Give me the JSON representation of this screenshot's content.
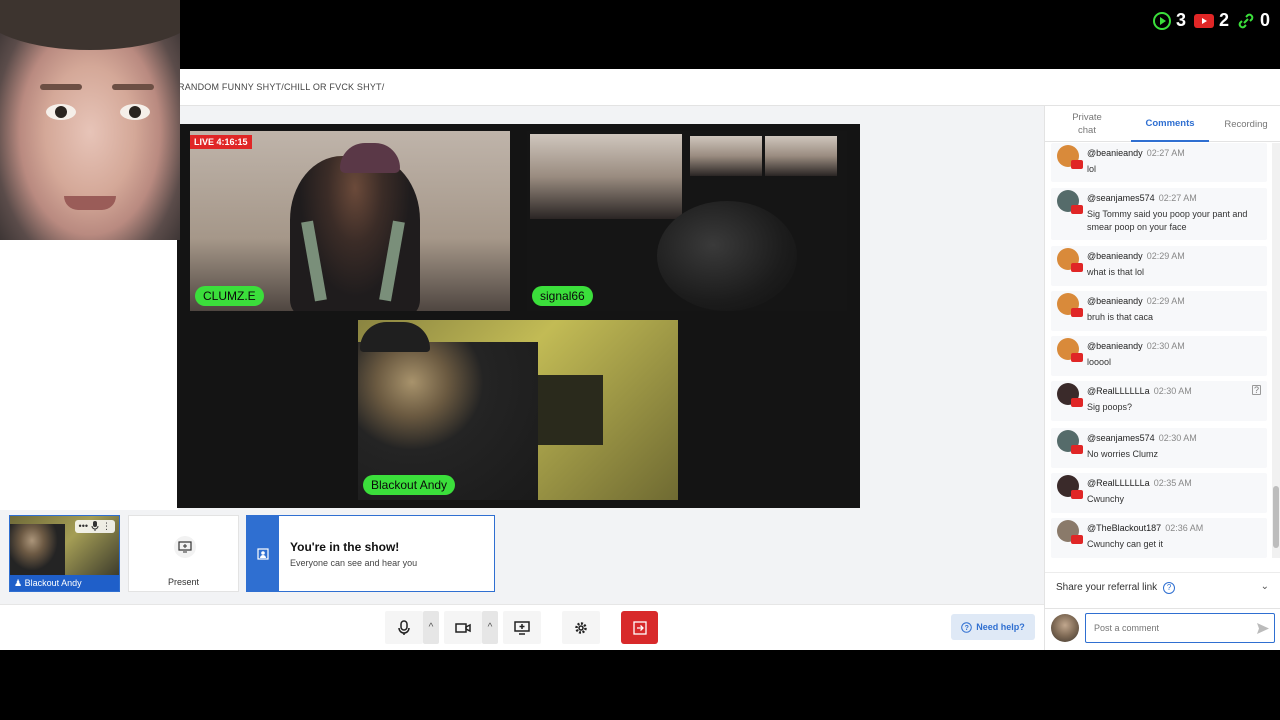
{
  "stats": {
    "play_count": "3",
    "youtube_count": "2",
    "link_count": "0"
  },
  "url": {
    "text": "RANDOM FUNNY SHYT/CHILL OR FVCK SHYT/"
  },
  "stage": {
    "live_badge": "LIVE 4:16:15",
    "participants": [
      {
        "name": "CLUMZ.E"
      },
      {
        "name": "signal66"
      },
      {
        "name": "Blackout Andy"
      }
    ]
  },
  "bottom": {
    "self_label": "Blackout Andy",
    "present_label": "Present",
    "inshow_title": "You're in the show!",
    "inshow_sub": "Everyone can see and hear you"
  },
  "toolbar": {
    "help_label": "Need help?",
    "caret": "^"
  },
  "panel": {
    "tabs": [
      {
        "label": "Private chat"
      },
      {
        "label": "Comments"
      },
      {
        "label": "Recording"
      }
    ],
    "comments": [
      {
        "user": "@beanieandy",
        "time": "02:27 AM",
        "text": "lol",
        "avatar_color": "#d98a3a"
      },
      {
        "user": "@seanjames574",
        "time": "02:27 AM",
        "text": "Sig Tommy said you poop your pant and smear poop on your face",
        "avatar_color": "#556b6a"
      },
      {
        "user": "@beanieandy",
        "time": "02:29 AM",
        "text": "what is that lol",
        "avatar_color": "#d98a3a"
      },
      {
        "user": "@beanieandy",
        "time": "02:29 AM",
        "text": "bruh is that caca",
        "avatar_color": "#d98a3a"
      },
      {
        "user": "@beanieandy",
        "time": "02:30 AM",
        "text": "looool",
        "avatar_color": "#d98a3a"
      },
      {
        "user": "@RealLLLLLLa",
        "time": "02:30 AM",
        "text": "Sig poops?",
        "avatar_color": "#3a2a2a"
      },
      {
        "user": "@seanjames574",
        "time": "02:30 AM",
        "text": "No worries Clumz",
        "avatar_color": "#556b6a"
      },
      {
        "user": "@RealLLLLLLa",
        "time": "02:35 AM",
        "text": "Cwunchy",
        "avatar_color": "#3a2a2a"
      },
      {
        "user": "@TheBlackout187",
        "time": "02:36 AM",
        "text": "Cwunchy can get it",
        "avatar_color": "#8a7a6a"
      }
    ],
    "referral_label": "Share your referral link",
    "composer_placeholder": "Post a comment"
  },
  "colors": {
    "accent": "#2f6fd1",
    "live": "#e02626",
    "name_tag": "#3bdf3b",
    "leave": "#d8292a"
  }
}
